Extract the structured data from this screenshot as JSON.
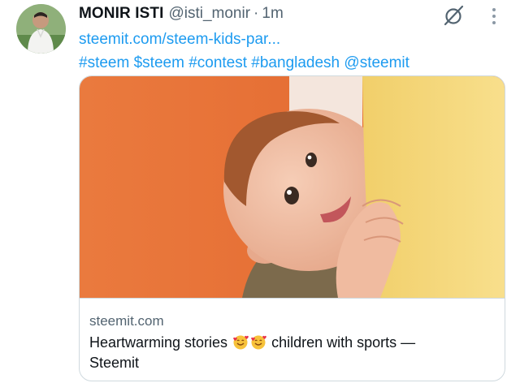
{
  "tweet": {
    "author": {
      "display_name": "MONIR ISTI",
      "handle": "@isti_monir",
      "avatar_icon": "user-photo"
    },
    "separator": "·",
    "timestamp": "1m",
    "link_text": "steemit.com/steem-kids-par...",
    "hashtags": [
      "#steem",
      "$steem",
      "#contest",
      "#bangladesh",
      "@steemit"
    ],
    "actions": {
      "grok_icon": "grok-slash-icon",
      "more_icon": "more-vertical-icon"
    }
  },
  "card": {
    "domain": "steemit.com",
    "title_before": "Heartwarming stories",
    "title_emoji": "smiling-face-with-hearts",
    "title_after": "children with sports —",
    "title_line2": "Steemit",
    "image_description_icon": "baby-peeking-photo"
  },
  "colors": {
    "link_blue": "#1d9bf0",
    "text_primary": "#0f1419",
    "text_secondary": "#536471",
    "border": "#cfd9de",
    "card_orange": "#e8743a",
    "card_yellow": "#f6d978"
  }
}
